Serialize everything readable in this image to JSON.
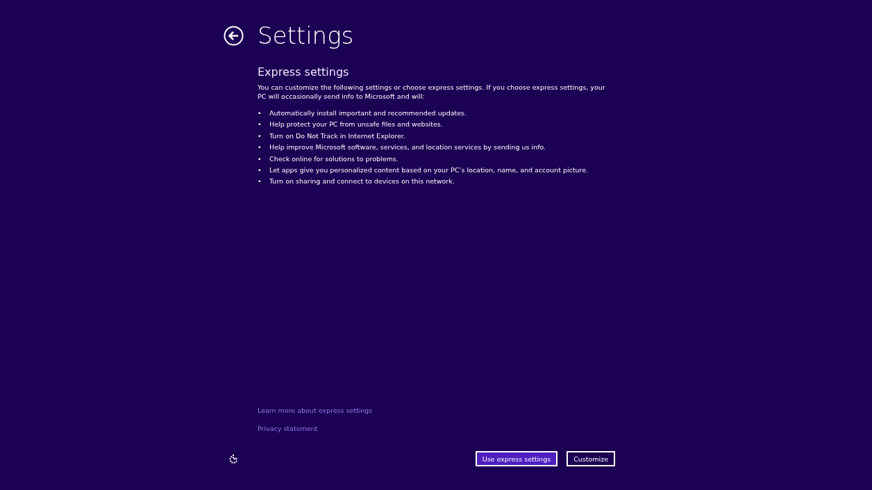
{
  "title": "Settings",
  "section": {
    "heading": "Express settings",
    "intro": "You can customize the following settings or choose express settings. If you choose express settings, your PC will occasionally send info to Microsoft and will:",
    "items": [
      "Automatically install important and recommended updates.",
      "Help protect your PC from unsafe files and websites.",
      "Turn on Do Not Track in Internet Explorer.",
      "Help improve Microsoft software, services, and location services by sending us info.",
      "Check online for solutions to problems.",
      "Let apps give you personalized content based on your PC’s location, name, and account picture.",
      "Turn on sharing and connect to devices on this network."
    ],
    "bullet": "•"
  },
  "links": [
    "Learn more about express settings",
    "Privacy statement"
  ],
  "buttons": [
    {
      "label": "Use express settings",
      "kind": "primary"
    },
    {
      "label": "Customize",
      "kind": "secondary"
    }
  ]
}
